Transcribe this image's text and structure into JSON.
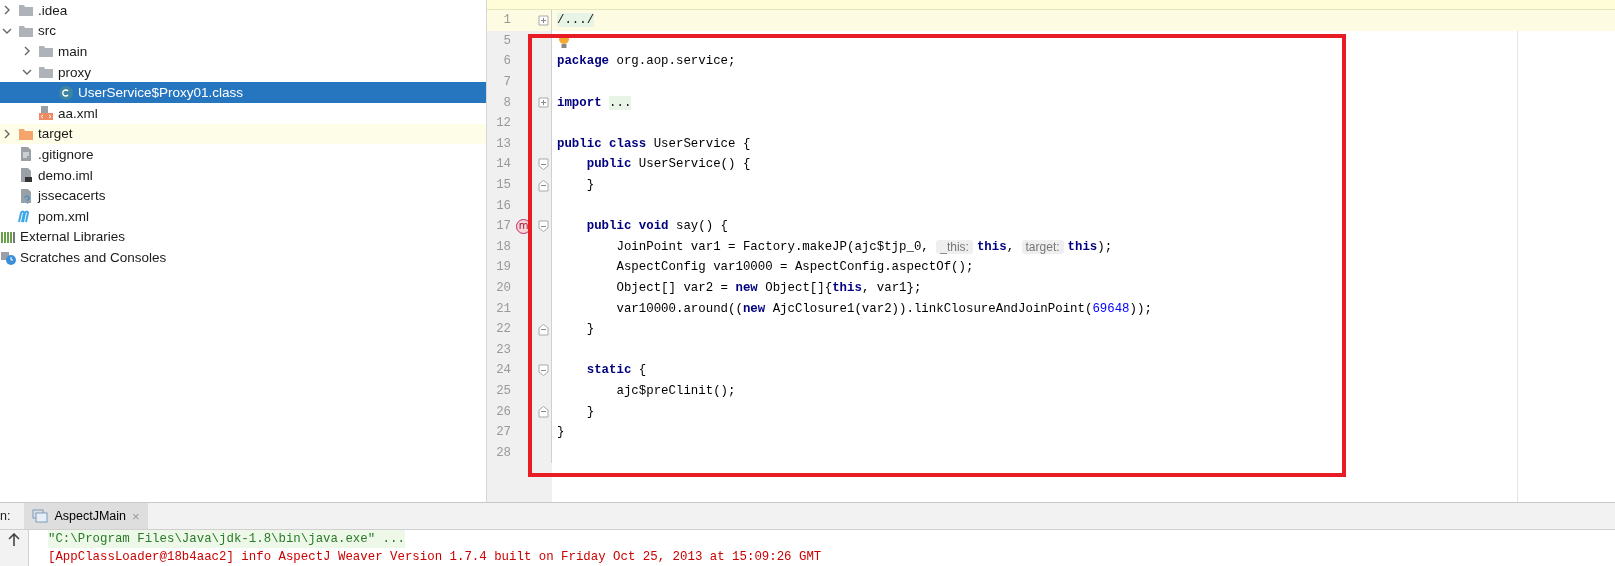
{
  "project_tree": {
    "items": [
      {
        "label": ".idea",
        "kind": "folder",
        "expanded": false,
        "selected": false
      },
      {
        "label": "src",
        "kind": "folder",
        "expanded": true,
        "selected": false,
        "children": [
          {
            "label": "main",
            "kind": "folder",
            "expanded": false,
            "selected": false
          },
          {
            "label": "proxy",
            "kind": "folder",
            "expanded": true,
            "selected": false,
            "children": [
              {
                "label": "UserService$Proxy01.class",
                "kind": "class",
                "selected": true
              }
            ]
          },
          {
            "label": "aa.xml",
            "kind": "xml",
            "selected": false
          }
        ]
      },
      {
        "label": "target",
        "kind": "excluded-folder",
        "expanded": false,
        "selected": false
      },
      {
        "label": ".gitignore",
        "kind": "text",
        "selected": false
      },
      {
        "label": "demo.iml",
        "kind": "iml",
        "selected": false
      },
      {
        "label": "jssecacerts",
        "kind": "unknown",
        "selected": false
      },
      {
        "label": "pom.xml",
        "kind": "maven",
        "selected": false
      }
    ],
    "roots": [
      {
        "label": "External Libraries",
        "kind": "libraries",
        "selected": false
      },
      {
        "label": "Scratches and Consoles",
        "kind": "scratches",
        "selected": false
      }
    ]
  },
  "editor": {
    "lines": [
      {
        "number": "1",
        "fold": {
          "kind": "expand"
        },
        "highlighted": true,
        "tokens": [
          {
            "kind": "folded",
            "text": "/.../"
          }
        ]
      },
      {
        "number": "5",
        "marker": {
          "kind": "bulb"
        },
        "highlighted": false
      },
      {
        "number": "6",
        "highlighted": false,
        "tokens": [
          {
            "kind": "keyword",
            "text": "package"
          },
          {
            "kind": "plain",
            "text": " org.aop.service;"
          }
        ]
      },
      {
        "number": "7",
        "highlighted": false
      },
      {
        "number": "8",
        "fold": {
          "kind": "expand"
        },
        "highlighted": false,
        "tokens": [
          {
            "kind": "keyword",
            "text": "import "
          },
          {
            "kind": "folded",
            "text": "..."
          }
        ]
      },
      {
        "number": "12",
        "highlighted": false
      },
      {
        "number": "13",
        "highlighted": false,
        "tokens": [
          {
            "kind": "keyword",
            "text": "public class"
          },
          {
            "kind": "plain",
            "text": " UserService {"
          }
        ]
      },
      {
        "number": "14",
        "fold": {
          "kind": "start"
        },
        "highlighted": false,
        "tokens": [
          {
            "kind": "keyword",
            "text": "    public"
          },
          {
            "kind": "plain",
            "text": " UserService() {"
          }
        ]
      },
      {
        "number": "15",
        "fold": {
          "kind": "end"
        },
        "highlighted": false,
        "tokens": [
          {
            "kind": "plain",
            "text": "    }"
          }
        ]
      },
      {
        "number": "16",
        "highlighted": false
      },
      {
        "number": "17",
        "fold": {
          "kind": "start"
        },
        "marker": {
          "kind": "method",
          "text": "m"
        },
        "highlighted": false,
        "tokens": [
          {
            "kind": "keyword",
            "text": "    public void"
          },
          {
            "kind": "plain",
            "text": " say() {"
          }
        ]
      },
      {
        "number": "18",
        "highlighted": false,
        "tokens": [
          {
            "kind": "plain",
            "text": "        JoinPoint var1 = Factory.makeJP(ajc$tjp_0, "
          },
          {
            "kind": "hint",
            "text": "_this:"
          },
          {
            "kind": "keyword",
            "text": "this"
          },
          {
            "kind": "plain",
            "text": ", "
          },
          {
            "kind": "hint",
            "text": "target:"
          },
          {
            "kind": "keyword",
            "text": "this"
          },
          {
            "kind": "plain",
            "text": ");"
          }
        ]
      },
      {
        "number": "19",
        "highlighted": false,
        "tokens": [
          {
            "kind": "plain",
            "text": "        AspectConfig var10000 = AspectConfig.aspectOf();"
          }
        ]
      },
      {
        "number": "20",
        "highlighted": false,
        "tokens": [
          {
            "kind": "plain",
            "text": "        Object[] var2 = "
          },
          {
            "kind": "keyword",
            "text": "new"
          },
          {
            "kind": "plain",
            "text": " Object[]{"
          },
          {
            "kind": "keyword",
            "text": "this"
          },
          {
            "kind": "plain",
            "text": ", var1};"
          }
        ]
      },
      {
        "number": "21",
        "highlighted": false,
        "tokens": [
          {
            "kind": "plain",
            "text": "        var10000.around(("
          },
          {
            "kind": "keyword",
            "text": "new"
          },
          {
            "kind": "plain",
            "text": " AjcClosure1(var2)).linkClosureAndJoinPoint("
          },
          {
            "kind": "number",
            "text": "69648"
          },
          {
            "kind": "plain",
            "text": "));"
          }
        ]
      },
      {
        "number": "22",
        "fold": {
          "kind": "end"
        },
        "highlighted": false,
        "tokens": [
          {
            "kind": "plain",
            "text": "    }"
          }
        ]
      },
      {
        "number": "23",
        "highlighted": false
      },
      {
        "number": "24",
        "fold": {
          "kind": "start"
        },
        "highlighted": false,
        "tokens": [
          {
            "kind": "keyword",
            "text": "    static"
          },
          {
            "kind": "plain",
            "text": " {"
          }
        ]
      },
      {
        "number": "25",
        "highlighted": false,
        "tokens": [
          {
            "kind": "plain",
            "text": "        ajc$preClinit();"
          }
        ]
      },
      {
        "number": "26",
        "fold": {
          "kind": "end"
        },
        "highlighted": false,
        "tokens": [
          {
            "kind": "plain",
            "text": "    }"
          }
        ]
      },
      {
        "number": "27",
        "highlighted": false,
        "tokens": [
          {
            "kind": "plain",
            "text": "}"
          }
        ]
      },
      {
        "number": "28",
        "highlighted": false
      }
    ]
  },
  "run_panel": {
    "label": "n:",
    "tabs": [
      {
        "label": "AspectJMain",
        "close": "×",
        "selected": true
      }
    ],
    "console": [
      {
        "kind": "command",
        "text": "\"C:\\Program Files\\Java\\jdk-1.8\\bin\\java.exe\" ..."
      },
      {
        "kind": "error",
        "text": "[AppClassLoader@18b4aac2] info AspectJ Weaver Version 1.7.4 built on Friday Oct 25, 2013 at 15:09:26 GMT"
      }
    ]
  }
}
